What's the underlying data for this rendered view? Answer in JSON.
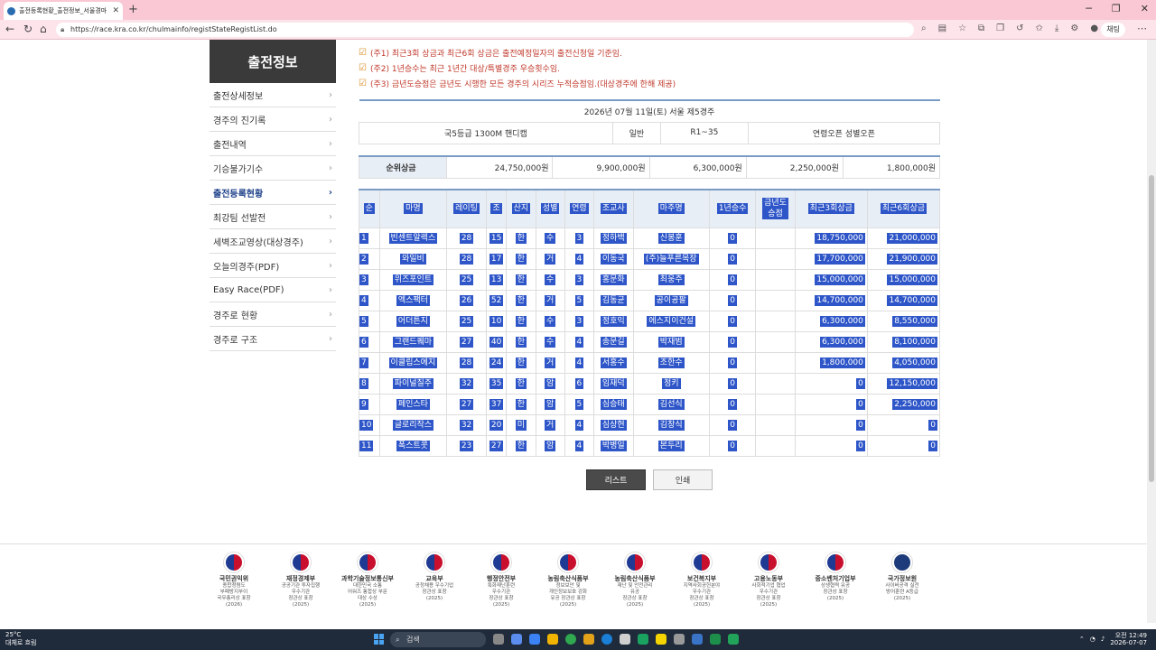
{
  "browser": {
    "tab_title": "출전등록현황_출전정보_서울경마",
    "url": "https://race.kra.co.kr/chulmainfo/registStateRegistList.do",
    "profile_label": "채팅"
  },
  "sidebar": {
    "title": "출전정보",
    "items": [
      {
        "label": "출전상세정보"
      },
      {
        "label": "경주의 진기록"
      },
      {
        "label": "출전내역"
      },
      {
        "label": "기승불가기수"
      },
      {
        "label": "출전등록현황",
        "active": true
      },
      {
        "label": "최강팀 선발전"
      },
      {
        "label": "세벽조교영상(대상경주)"
      },
      {
        "label": "오늘의경주(PDF)"
      },
      {
        "label": "Easy Race(PDF)"
      },
      {
        "label": "경주로 현황"
      },
      {
        "label": "경주로 구조"
      }
    ]
  },
  "notes": [
    "(주1) 최근3회 상금과 최근6회 상금은 출전예정일자의 출전신청일 기준임.",
    "(주2) 1년승수는 최근 1년간 대상/특별경주 우승횟수임.",
    "(주3) 금년도승점은 금년도 시행한 모든 경주의 시리즈 누적승점임.(대상경주에 한해 제공)"
  ],
  "race": {
    "header": "2026년 07월 11일(토) 서울 제5경주",
    "grade": "국5등급 1300M 핸디캡",
    "type": "일반",
    "rating": "R1~35",
    "condition": "연령오픈 성별오픈"
  },
  "prizes": {
    "label": "순위상금",
    "values": [
      "24,750,000원",
      "9,900,000원",
      "6,300,000원",
      "2,250,000원",
      "1,800,000원"
    ]
  },
  "entries": {
    "columns": [
      "순",
      "마명",
      "레이팅",
      "조",
      "산지",
      "성별",
      "연령",
      "조교사",
      "마주명",
      "1년승수",
      "금년도\n승점",
      "최근3회상금",
      "최근6회상금"
    ],
    "rows": [
      [
        "1",
        "빈센트알렉스",
        "28",
        "15",
        "한",
        "수",
        "3",
        "정하백",
        "신봉훈",
        "0",
        "",
        "18,750,000",
        "21,000,000"
      ],
      [
        "2",
        "와일비",
        "28",
        "17",
        "한",
        "거",
        "4",
        "이동국",
        "(주)늘푸른목장",
        "0",
        "",
        "17,700,000",
        "21,900,000"
      ],
      [
        "3",
        "위즈포인트",
        "25",
        "13",
        "한",
        "수",
        "3",
        "홍문화",
        "최웅주",
        "0",
        "",
        "15,000,000",
        "15,000,000"
      ],
      [
        "4",
        "엑스팩터",
        "26",
        "52",
        "한",
        "거",
        "5",
        "김동균",
        "공이공팔",
        "0",
        "",
        "14,700,000",
        "14,700,000"
      ],
      [
        "5",
        "어더튼지",
        "25",
        "10",
        "한",
        "수",
        "3",
        "정호익",
        "에스지이건설",
        "0",
        "",
        "6,300,000",
        "8,550,000"
      ],
      [
        "6",
        "그랜드퀘마",
        "27",
        "40",
        "한",
        "수",
        "4",
        "송문길",
        "박재범",
        "0",
        "",
        "6,300,000",
        "8,100,000"
      ],
      [
        "7",
        "이클립스에지",
        "28",
        "24",
        "한",
        "거",
        "4",
        "서홍수",
        "조한수",
        "0",
        "",
        "1,800,000",
        "4,050,000"
      ],
      [
        "8",
        "파이널질주",
        "32",
        "35",
        "한",
        "암",
        "6",
        "임재덕",
        "정키",
        "0",
        "",
        "0",
        "12,150,000"
      ],
      [
        "9",
        "페인스타",
        "27",
        "37",
        "한",
        "암",
        "5",
        "심승태",
        "김선식",
        "0",
        "",
        "0",
        "2,250,000"
      ],
      [
        "10",
        "글로리작스",
        "32",
        "20",
        "미",
        "거",
        "4",
        "심상현",
        "김창식",
        "0",
        "",
        "0",
        "0"
      ],
      [
        "11",
        "폭스트콧",
        "23",
        "27",
        "한",
        "암",
        "4",
        "박병일",
        "본두리",
        "0",
        "",
        "0",
        "0"
      ]
    ]
  },
  "buttons": {
    "list": "리스트",
    "print": "인쇄"
  },
  "awards": [
    {
      "name": "국민권익위",
      "desc": "종합청렴도\n부패방지부이\n국무총리상 표창\n(2026)"
    },
    {
      "name": "재정경제부",
      "desc": "공공기관 투자집행\n우수기관\n장관상 표창\n(2025)"
    },
    {
      "name": "과학기술정보통신부",
      "desc": "대한민국 소통\n어워즈 통합상 부문\n대상 수상\n(2025)"
    },
    {
      "name": "교육부",
      "desc": "공정채용 우수기업\n장관상 표창\n(2025)"
    },
    {
      "name": "행정안전부",
      "desc": "특화재난훈련\n우수기관\n장관상 표창\n(2025)"
    },
    {
      "name": "농림축산식품부",
      "desc": "정보보안 및\n개인정보보호 강화\n유공 장관상 표창\n(2025)"
    },
    {
      "name": "농림축산식품부",
      "desc": "재난 및 안전관리\n유공\n장관상 표창\n(2025)"
    },
    {
      "name": "보건복지부",
      "desc": "지역사회공헌분야\n우수기관\n장관상 표창\n(2025)"
    },
    {
      "name": "고용노동부",
      "desc": "사회적기업 협업\n우수기관\n장관상 표창\n(2025)"
    },
    {
      "name": "중소벤처기업부",
      "desc": "상생협력 유공\n장관상 표창\n(2025)"
    },
    {
      "name": "국가정보원",
      "desc": "사이버공격 실전\n방어훈련 A등급\n(2025)"
    }
  ],
  "taskbar": {
    "temp": "25°C",
    "weather": "대체로 흐림",
    "search": "검색",
    "time": "오전 12:49",
    "date": "2026-07-07"
  }
}
